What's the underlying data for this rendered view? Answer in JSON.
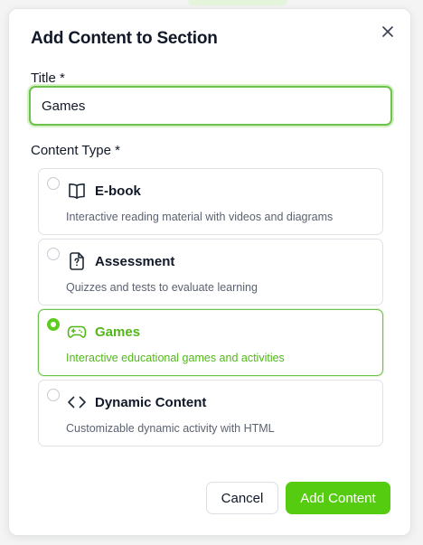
{
  "modal": {
    "title": "Add Content to Section",
    "close_icon": "close-icon"
  },
  "form": {
    "title_label": "Title *",
    "title_value": "Games",
    "content_type_label": "Content Type *"
  },
  "options": [
    {
      "id": "ebook",
      "icon": "book-icon",
      "title": "E-book",
      "description": "Interactive reading material with videos and diagrams",
      "selected": false
    },
    {
      "id": "assessment",
      "icon": "question-file-icon",
      "title": "Assessment",
      "description": "Quizzes and tests to evaluate learning",
      "selected": false
    },
    {
      "id": "games",
      "icon": "gamepad-icon",
      "title": "Games",
      "description": "Interactive educational games and activities",
      "selected": true
    },
    {
      "id": "dynamic",
      "icon": "code-icon",
      "title": "Dynamic Content",
      "description": "Customizable dynamic activity with HTML",
      "selected": false
    }
  ],
  "actions": {
    "cancel_label": "Cancel",
    "add_label": "Add Content"
  },
  "colors": {
    "accent": "#55cc10",
    "accent_text": "#52b81a",
    "focus_border": "#6cc24a"
  }
}
